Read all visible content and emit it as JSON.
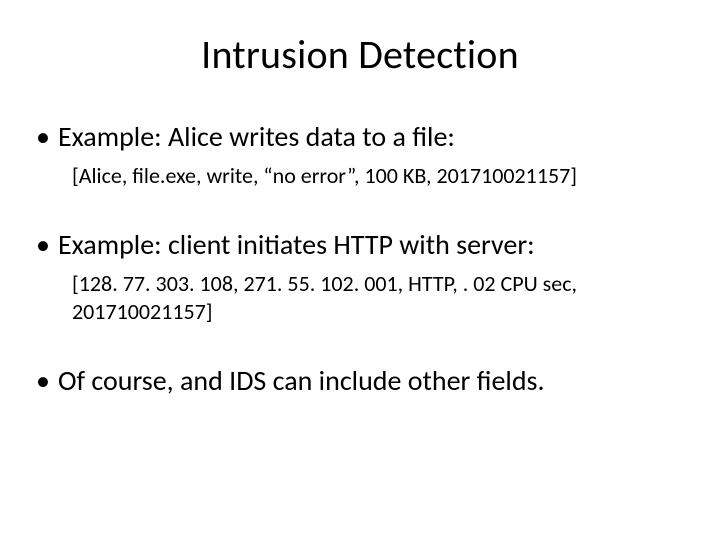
{
  "title": "Intrusion Detection",
  "bullets": [
    {
      "text": "Example: Alice writes data to a file:",
      "sub": "[Alice, file.exe, write, “no error”, 100 KB, 201710021157]"
    },
    {
      "text": "Example: client initiates HTTP with server:",
      "sub": "[128. 77. 303. 108, 271. 55. 102. 001, HTTP, . 02 CPU sec, 201710021157]"
    },
    {
      "text": "Of course, and IDS can include other fields.",
      "sub": null
    }
  ]
}
